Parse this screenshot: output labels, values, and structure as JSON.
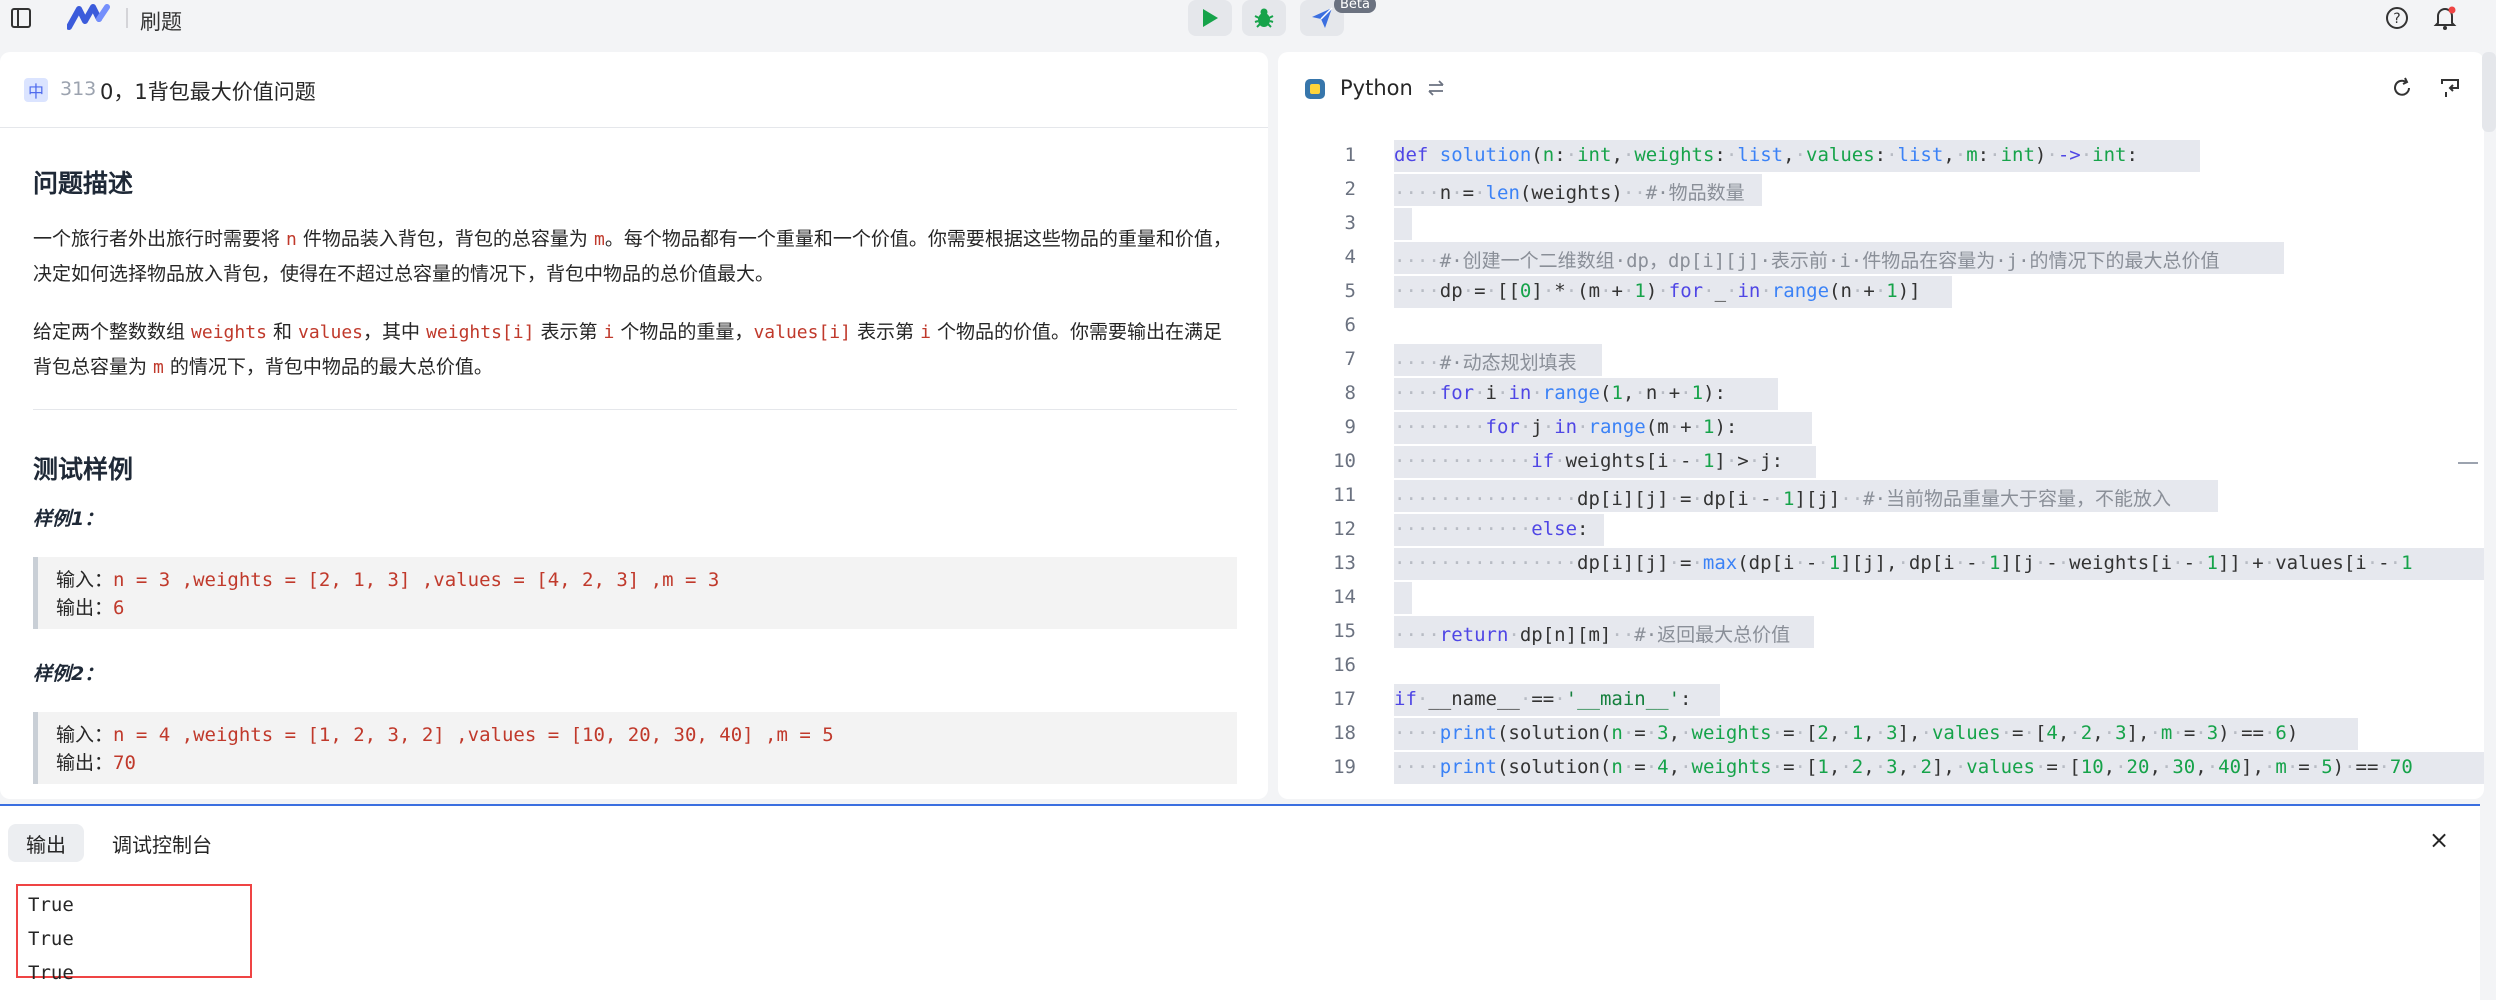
{
  "topbar": {
    "title": "刷题",
    "beta_label": "Beta",
    "icons": [
      "sidebar-toggle-icon",
      "logo-icon",
      "run-icon",
      "debug-bug-icon",
      "submit-plane-icon",
      "help-icon",
      "bell-icon"
    ]
  },
  "problem": {
    "difficulty": "中",
    "id": "313",
    "title": "0，1背包最大价值问题",
    "section_desc": "问题描述",
    "p1_a": "一个旅行者外出旅行时需要将 ",
    "p1_n": "n",
    "p1_b": " 件物品装入背包，背包的总容量为 ",
    "p1_m": "m",
    "p1_c": "。每个物品都有一个重量和一个价值。你需要根据这些物品的重量和价值，决定如何选择物品放入背包，使得在不超过总容量的情况下，背包中物品的总价值最大。",
    "p2_a": "给定两个整数数组 ",
    "p2_weights": "weights",
    "p2_b": " 和 ",
    "p2_values": "values",
    "p2_c": "，其中 ",
    "p2_wi": "weights[i]",
    "p2_d": " 表示第 ",
    "p2_i": "i",
    "p2_e": " 个物品的重量，",
    "p2_vi": "values[i]",
    "p2_f": " 表示第 ",
    "p2_i2": "i",
    "p2_g": " 个物品的价值。你需要输出在满足背包总容量为 ",
    "p2_m": "m",
    "p2_h": " 的情况下，背包中物品的最大总价值。",
    "section_tests": "测试样例",
    "examples": [
      {
        "label": "样例1：",
        "input_prefix": "输入：",
        "input": "n = 3 ,weights = [2, 1, 3] ,values = [4, 2, 3] ,m = 3",
        "output_prefix": "输出：",
        "output": "6"
      },
      {
        "label": "样例2：",
        "input_prefix": "输入：",
        "input": "n = 4 ,weights = [1, 2, 3, 2] ,values = [10, 20, 30, 40] ,m = 5",
        "output_prefix": "输出：",
        "output": "70"
      }
    ]
  },
  "editor": {
    "language": "Python",
    "line_numbers": [
      "1",
      "2",
      "3",
      "4",
      "5",
      "6",
      "7",
      "8",
      "9",
      "10",
      "11",
      "12",
      "13",
      "14",
      "15",
      "16",
      "17",
      "18",
      "19"
    ]
  },
  "bottom": {
    "tab_output": "输出",
    "tab_console": "调试控制台",
    "close_label": "×",
    "output_lines": [
      "True",
      "True",
      "True"
    ]
  }
}
